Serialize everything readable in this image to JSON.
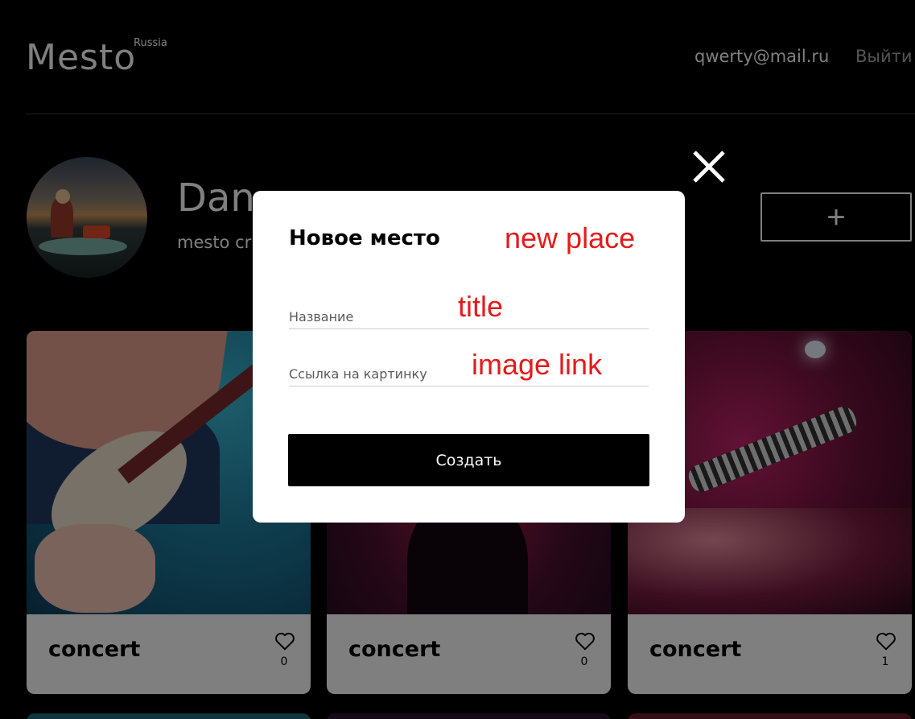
{
  "header": {
    "logo": "Mesto",
    "logo_superscript": "Russia",
    "email": "qwerty@mail.ru",
    "logout_label": "Выйти"
  },
  "profile": {
    "name": "Dan",
    "about": "mesto cr",
    "add_button_label": "+"
  },
  "cards": [
    {
      "title": "concert",
      "likes": "0"
    },
    {
      "title": "concert",
      "likes": "0"
    },
    {
      "title": "concert",
      "likes": "1"
    }
  ],
  "popup": {
    "title": "Новое место",
    "title_annotation": "new place",
    "name_placeholder": "Название",
    "name_annotation": "title",
    "link_placeholder": "Ссылка на картинку",
    "link_annotation": "image link",
    "submit_label": "Создать"
  },
  "colors": {
    "background": "#000000",
    "popup_background": "#ffffff",
    "annotation": "#e41b1b",
    "overlay": "rgba(0,0,0,0.5)"
  },
  "icons": {
    "close": "close-icon",
    "like": "heart-outline-icon",
    "add": "plus-icon"
  }
}
